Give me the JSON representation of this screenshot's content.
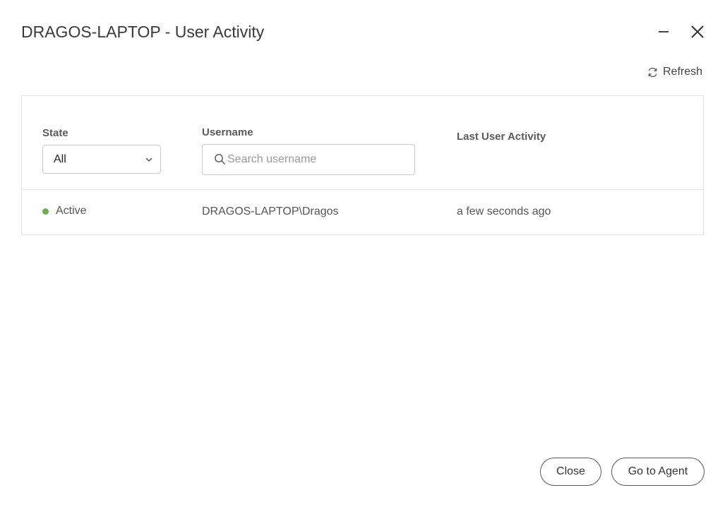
{
  "dialog": {
    "title": "DRAGOS-LAPTOP - User Activity"
  },
  "toolbar": {
    "refresh_label": "Refresh"
  },
  "filters": {
    "state_label": "State",
    "state_value": "All",
    "username_label": "Username",
    "username_placeholder": "Search username",
    "last_activity_label": "Last User Activity"
  },
  "rows": [
    {
      "state": "Active",
      "state_color": "#6ab04c",
      "username": "DRAGOS-LAPTOP\\Dragos",
      "last_activity": "a few seconds ago"
    }
  ],
  "footer": {
    "close_label": "Close",
    "go_to_agent_label": "Go to Agent"
  },
  "icons": {
    "minimize": "minimize-icon",
    "close": "close-icon",
    "refresh": "refresh-icon",
    "search": "search-icon",
    "chevron": "chevron-down-icon"
  }
}
